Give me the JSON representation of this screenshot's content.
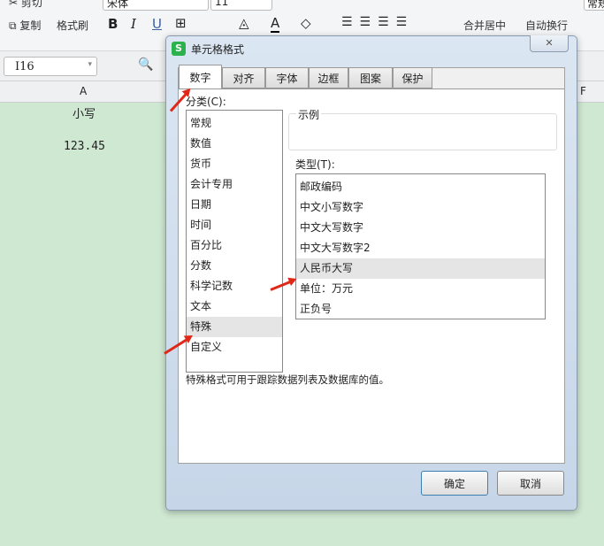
{
  "ribbon": {
    "cut": "剪切",
    "copy": "复制",
    "format_painter": "格式刷",
    "font_name": "宋体",
    "font_size": "11",
    "bold": "B",
    "italic": "I",
    "underline": "U",
    "merge_center": "合并居中",
    "wrap_text": "自动换行",
    "number_format": "常规"
  },
  "formula_bar": {
    "cell_ref": "I16"
  },
  "sheet": {
    "col_a": "A",
    "col_f": "F",
    "cell_a1": "小写",
    "cell_a3": "123.45"
  },
  "dialog": {
    "title": "单元格格式",
    "close": "✕",
    "tabs": [
      "数字",
      "对齐",
      "字体",
      "边框",
      "图案",
      "保护"
    ],
    "category_label": "分类(C):",
    "categories": [
      "常规",
      "数值",
      "货币",
      "会计专用",
      "日期",
      "时间",
      "百分比",
      "分数",
      "科学记数",
      "文本",
      "特殊",
      "自定义"
    ],
    "selected_category": "特殊",
    "sample_label": "示例",
    "type_label": "类型(T):",
    "types": [
      "邮政编码",
      "中文小写数字",
      "中文大写数字",
      "中文大写数字2",
      "人民币大写",
      "单位：万元",
      "正负号"
    ],
    "selected_type": "人民币大写",
    "description": "特殊格式可用于跟踪数据列表及数据库的值。",
    "ok": "确定",
    "cancel": "取消"
  },
  "colors": {
    "sheet_bg": "#cfe8d2",
    "arrow": "#e02818",
    "app_icon": "#2bb24c"
  }
}
